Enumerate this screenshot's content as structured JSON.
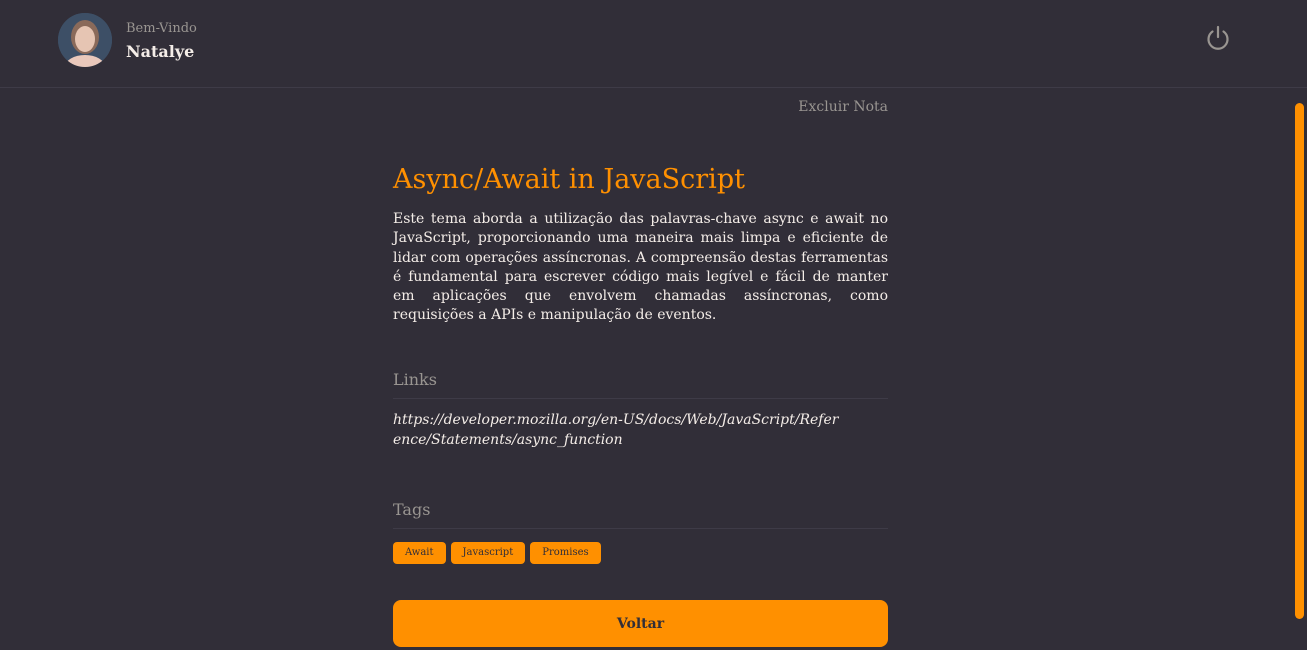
{
  "header": {
    "welcome_label": "Bem-Vindo",
    "user_name": "Natalye"
  },
  "note": {
    "delete_label": "Excluir Nota",
    "title": "Async/Await in JavaScript",
    "description": "Este tema aborda a utilização das palavras-chave async e await no JavaScript, proporcionando uma maneira mais limpa e eficiente de lidar com operações assíncronas. A compreensão destas ferramentas é fundamental para escrever código mais legível e fácil de manter em aplicações que envolvem chamadas assíncronas, como requisições a APIs e manipulação de eventos.",
    "links_title": "Links",
    "links": [
      "https://developer.mozilla.org/en-US/docs/Web/JavaScript/Reference/Statements/async_function"
    ],
    "tags_title": "Tags",
    "tags": [
      "Await",
      "Javascript",
      "Promises"
    ],
    "back_label": "Voltar"
  },
  "colors": {
    "background": "#312e38",
    "accent": "#ff9000",
    "muted_text": "#999591",
    "text": "#f4ede8"
  },
  "icons": {
    "logout": "power-icon"
  }
}
